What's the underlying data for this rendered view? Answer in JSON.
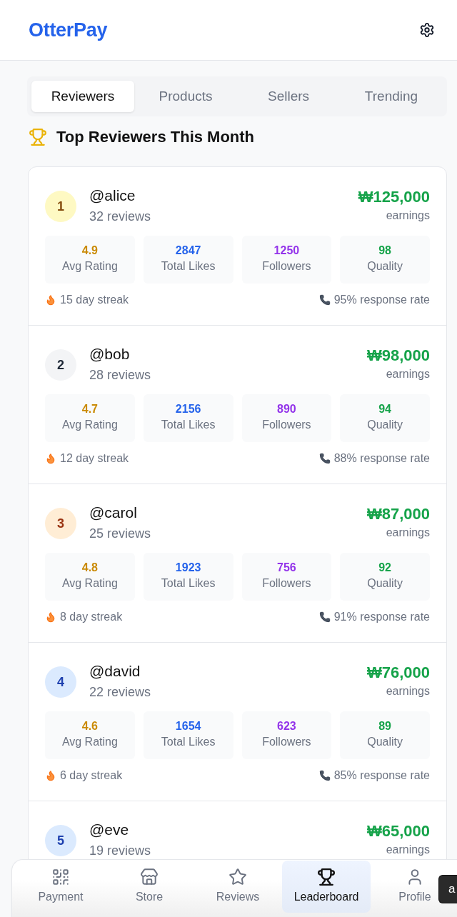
{
  "app": {
    "title": "OtterPay"
  },
  "tabs": [
    {
      "label": "Reviewers",
      "selected": true
    },
    {
      "label": "Products",
      "selected": false
    },
    {
      "label": "Sellers",
      "selected": false
    },
    {
      "label": "Trending",
      "selected": false
    }
  ],
  "section": {
    "title": "Top Reviewers This Month"
  },
  "reviewers": [
    {
      "rank": "1",
      "kind": "gold",
      "handle": "@alice",
      "reviews": "32 reviews",
      "earnings": "₩125,000",
      "earnings_label": "earnings",
      "stats": [
        {
          "value": "4.9",
          "label": "Avg Rating",
          "color": "#ca8a04"
        },
        {
          "value": "2847",
          "label": "Total Likes",
          "color": "#2563eb"
        },
        {
          "value": "1250",
          "label": "Followers",
          "color": "#9333ea"
        },
        {
          "value": "98",
          "label": "Quality",
          "color": "#16a34a"
        }
      ],
      "streak": "15 day streak",
      "response_rate": "95% response rate"
    },
    {
      "rank": "2",
      "kind": "silver",
      "handle": "@bob",
      "reviews": "28 reviews",
      "earnings": "₩98,000",
      "earnings_label": "earnings",
      "stats": [
        {
          "value": "4.7",
          "label": "Avg Rating",
          "color": "#ca8a04"
        },
        {
          "value": "2156",
          "label": "Total Likes",
          "color": "#2563eb"
        },
        {
          "value": "890",
          "label": "Followers",
          "color": "#9333ea"
        },
        {
          "value": "94",
          "label": "Quality",
          "color": "#16a34a"
        }
      ],
      "streak": "12 day streak",
      "response_rate": "88% response rate"
    },
    {
      "rank": "3",
      "kind": "bronze",
      "handle": "@carol",
      "reviews": "25 reviews",
      "earnings": "₩87,000",
      "earnings_label": "earnings",
      "stats": [
        {
          "value": "4.8",
          "label": "Avg Rating",
          "color": "#ca8a04"
        },
        {
          "value": "1923",
          "label": "Total Likes",
          "color": "#2563eb"
        },
        {
          "value": "756",
          "label": "Followers",
          "color": "#9333ea"
        },
        {
          "value": "92",
          "label": "Quality",
          "color": "#16a34a"
        }
      ],
      "streak": "8 day streak",
      "response_rate": "91% response rate"
    },
    {
      "rank": "4",
      "kind": "plain",
      "handle": "@david",
      "reviews": "22 reviews",
      "earnings": "₩76,000",
      "earnings_label": "earnings",
      "stats": [
        {
          "value": "4.6",
          "label": "Avg Rating",
          "color": "#ca8a04"
        },
        {
          "value": "1654",
          "label": "Total Likes",
          "color": "#2563eb"
        },
        {
          "value": "623",
          "label": "Followers",
          "color": "#9333ea"
        },
        {
          "value": "89",
          "label": "Quality",
          "color": "#16a34a"
        }
      ],
      "streak": "6 day streak",
      "response_rate": "85% response rate"
    },
    {
      "rank": "5",
      "kind": "plain",
      "handle": "@eve",
      "reviews": "19 reviews",
      "earnings": "₩65,000",
      "earnings_label": "earnings"
    }
  ],
  "bottom_nav": [
    {
      "label": "Payment",
      "selected": false
    },
    {
      "label": "Store",
      "selected": false
    },
    {
      "label": "Reviews",
      "selected": false
    },
    {
      "label": "Leaderboard",
      "selected": true
    },
    {
      "label": "Profile",
      "selected": false
    }
  ],
  "floating_chip": {
    "text": "a"
  }
}
